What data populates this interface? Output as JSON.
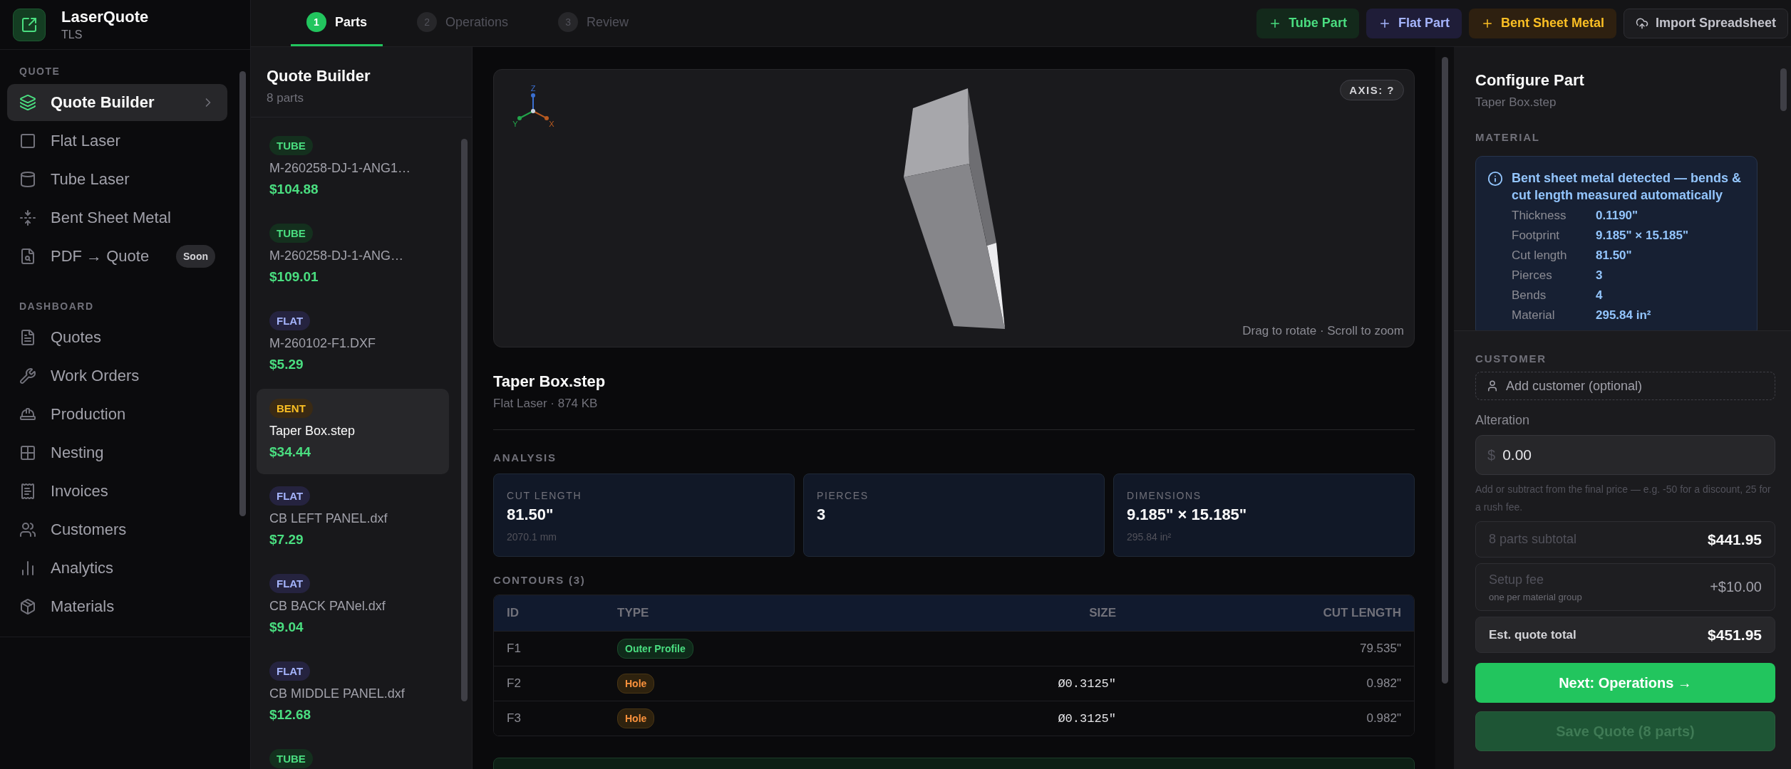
{
  "app": {
    "name": "LaserQuote",
    "org": "TLS"
  },
  "sidebar": {
    "sections": [
      {
        "title": "QUOTE",
        "items": [
          {
            "label": "Quote Builder",
            "selected": true
          },
          {
            "label": "Flat Laser",
            "selected": false
          },
          {
            "label": "Tube Laser",
            "selected": false
          },
          {
            "label": "Bent Sheet Metal",
            "selected": false
          },
          {
            "label": "PDF → Quote",
            "badge": "Soon",
            "selected": false
          }
        ]
      },
      {
        "title": "DASHBOARD",
        "items": [
          {
            "label": "Quotes",
            "selected": false
          },
          {
            "label": "Work Orders",
            "selected": false
          },
          {
            "label": "Production",
            "selected": false
          },
          {
            "label": "Nesting",
            "selected": false
          },
          {
            "label": "Invoices",
            "selected": false
          },
          {
            "label": "Customers",
            "selected": false
          },
          {
            "label": "Analytics",
            "selected": false
          },
          {
            "label": "Materials",
            "selected": false
          }
        ]
      }
    ]
  },
  "steps": [
    {
      "number": "1",
      "label": "Parts",
      "selected": true
    },
    {
      "number": "2",
      "label": "Operations",
      "selected": false
    },
    {
      "number": "3",
      "label": "Review",
      "selected": false
    }
  ],
  "actions": [
    {
      "kind": "tube",
      "label": "Tube Part"
    },
    {
      "kind": "flat",
      "label": "Flat Part"
    },
    {
      "kind": "bent",
      "label": "Bent Sheet Metal"
    },
    {
      "kind": "import",
      "label": "Import Spreadsheet"
    }
  ],
  "parts_panel": {
    "title": "Quote Builder",
    "count": "8 parts",
    "parts": [
      {
        "kind": "tube",
        "type": "TUBE",
        "name": "M-260258-DJ-1-ANG1…",
        "price": "$104.88",
        "selected": false
      },
      {
        "kind": "tube",
        "type": "TUBE",
        "name": "M-260258-DJ-1-ANG…",
        "price": "$109.01",
        "selected": false
      },
      {
        "kind": "flat",
        "type": "FLAT",
        "name": "M-260102-F1.DXF",
        "price": "$5.29",
        "selected": false
      },
      {
        "kind": "bent",
        "type": "BENT",
        "name": "Taper Box.step",
        "price": "$34.44",
        "selected": true
      },
      {
        "kind": "flat",
        "type": "FLAT",
        "name": "CB LEFT PANEL.dxf",
        "price": "$7.29",
        "selected": false
      },
      {
        "kind": "flat",
        "type": "FLAT",
        "name": "CB BACK PANel.dxf",
        "price": "$9.04",
        "selected": false
      },
      {
        "kind": "flat",
        "type": "FLAT",
        "name": "CB MIDDLE PANEL.dxf",
        "price": "$12.68",
        "selected": false
      },
      {
        "kind": "tube",
        "type": "TUBE",
        "selected": false
      }
    ]
  },
  "viewer": {
    "axes": [
      "Z",
      "Y",
      "X"
    ],
    "axis_badge": "AXIS: ?",
    "hint": "Drag to rotate · Scroll to zoom"
  },
  "part": {
    "name": "Taper Box.step",
    "meta": "Flat Laser · 874 KB"
  },
  "analysis": {
    "title": "ANALYSIS",
    "cards": [
      {
        "label": "CUT LENGTH",
        "value": "81.50\"",
        "sub": "2070.1 mm"
      },
      {
        "label": "PIERCES",
        "value": "3"
      },
      {
        "label": "DIMENSIONS",
        "value": "9.185\" × 15.185\"",
        "sub": "295.84 in²"
      }
    ]
  },
  "contours": {
    "title": "CONTOURS (3)",
    "columns": [
      "ID",
      "TYPE",
      "SIZE",
      "CUT LENGTH"
    ],
    "rows": [
      {
        "id": "F1",
        "kind": "outer",
        "type": "Outer Profile",
        "cut_length": "79.535\""
      },
      {
        "id": "F2",
        "kind": "hole",
        "type": "Hole",
        "size": "Ø0.3125\"",
        "cut_length": "0.982\""
      },
      {
        "id": "F3",
        "kind": "hole",
        "type": "Hole",
        "size": "Ø0.3125\"",
        "cut_length": "0.982\""
      }
    ]
  },
  "configure": {
    "title": "Configure Part",
    "subtitle": "Taper Box.step",
    "material_label": "MATERIAL",
    "notice": {
      "title": "Bent sheet metal detected — bends & cut length measured automatically",
      "rows": [
        {
          "label": "Thickness",
          "value": "0.1190\""
        },
        {
          "label": "Footprint",
          "value": "9.185\" × 15.185\""
        },
        {
          "label": "Cut length",
          "value": "81.50\""
        },
        {
          "label": "Pierces",
          "value": "3"
        },
        {
          "label": "Bends",
          "value": "4"
        },
        {
          "label": "Material",
          "value": "295.84 in²"
        }
      ]
    },
    "customer_label": "CUSTOMER",
    "customer_button": "Add customer (optional)",
    "alteration_label": "Alteration",
    "currency": "$",
    "alteration_value": "0.00",
    "alteration_help": "Add or subtract from the final price — e.g. -50 for a discount, 25 for a rush fee.",
    "summary": [
      {
        "kind": "subtotal",
        "label": "8 parts subtotal",
        "value": "$441.95"
      },
      {
        "kind": "fee",
        "label": "Setup fee",
        "note": "one per material group",
        "value": "+$10.00"
      },
      {
        "kind": "total",
        "label": "Est. quote total",
        "value": "$451.95"
      }
    ],
    "next": "Next: Operations →",
    "save": {
      "label": "Save Quote (8 parts)",
      "disabled": true
    }
  }
}
